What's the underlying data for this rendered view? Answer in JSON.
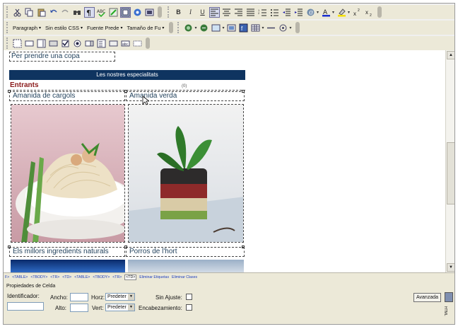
{
  "toolbar1": {
    "icons": [
      "cut-icon",
      "copy-icon",
      "paste-icon",
      "undo-icon",
      "redo-icon",
      "find-icon",
      "paragraph-marks-icon",
      "spellcheck-icon",
      "clean-icon",
      "design-view-icon",
      "preview-icon",
      "html-view-icon"
    ],
    "format": {
      "bold": "B",
      "italic": "I",
      "underline": "U"
    }
  },
  "toolbar2": {
    "block_format": "Paragraph",
    "css_style": "Sin estilo CSS",
    "font_name": "Fuente Prede",
    "font_size": "Tamaño de Fu"
  },
  "editor": {
    "row_copa": "Per prendre una copa",
    "header_bar": "Les nostres especialitats",
    "section_title": "Entrants",
    "cell_a": "Amanida de cargols",
    "cell_b": "Amanida verda",
    "cell_c": "Els millors ingredients naturals",
    "cell_d": "Porros de l'hort",
    "sel_marker": "(0)"
  },
  "tagpath": {
    "tags": [
      "F>",
      "<TABLE>",
      "<TBODY>",
      "<TR>",
      "<TD>",
      "<TABLE>",
      "<TBODY>",
      "<TR>"
    ],
    "current": "<TD>",
    "actions": [
      "Eliminar Etiquetas",
      "Eliminar Clases"
    ]
  },
  "props": {
    "title": "Propiedades de Celda",
    "identificador_label": "Identificador:",
    "ancho_label": "Ancho:",
    "alto_label": "Alto:",
    "horz_label": "Horz:",
    "vert_label": "Vert:",
    "horz_value": "Predeter",
    "vert_value": "Predeter",
    "sin_ajuste_label": "Sin Ajuste:",
    "encabezamiento_label": "Encabezamiento:",
    "avanzada_label": "Avanzada",
    "side_label": "HTML"
  },
  "colors": {
    "header_bar": "#0f3460",
    "section_title": "#8a1a1a",
    "cell_text": "#1f3f5a",
    "toolbar": "#ece9d8"
  }
}
